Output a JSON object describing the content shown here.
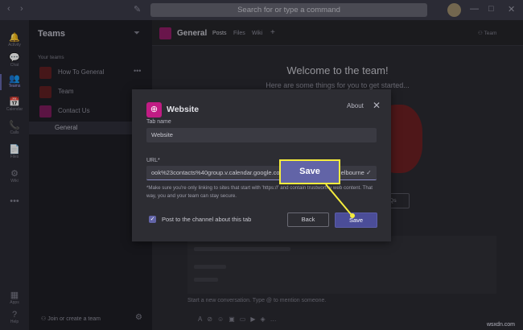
{
  "titlebar": {
    "back_icon": "‹",
    "forward_icon": "›",
    "compose_icon": "✎",
    "search_placeholder": "Search for or type a command",
    "minimize": "—",
    "maximize": "□",
    "close": "✕"
  },
  "rail": {
    "items": [
      {
        "icon": "bell-icon",
        "glyph": "🔔",
        "label": "Activity"
      },
      {
        "icon": "chat-icon",
        "glyph": "💬",
        "label": "Chat"
      },
      {
        "icon": "teams-icon",
        "glyph": "👥",
        "label": "Teams"
      },
      {
        "icon": "calendar-icon",
        "glyph": "📅",
        "label": "Calendar"
      },
      {
        "icon": "calls-icon",
        "glyph": "📞",
        "label": "Calls"
      },
      {
        "icon": "files-icon",
        "glyph": "📄",
        "label": "Files"
      },
      {
        "icon": "wiki-icon",
        "glyph": "⚙",
        "label": "Wiki"
      },
      {
        "icon": "more-icon",
        "glyph": "•••",
        "label": ""
      },
      {
        "icon": "apps-icon",
        "glyph": "▦",
        "label": "Apps"
      },
      {
        "icon": "help-icon",
        "glyph": "?",
        "label": "Help"
      }
    ]
  },
  "panel": {
    "title": "Teams",
    "your_teams_label": "Your teams",
    "teams": [
      {
        "name": "How To General"
      },
      {
        "name": "Team"
      },
      {
        "name": "Contact Us"
      }
    ],
    "channel": "General",
    "join_label": "Join or create a team"
  },
  "channel_header": {
    "name": "General",
    "tabs": [
      "Posts",
      "Files",
      "Wiki"
    ],
    "add_tab": "+",
    "team_button": "Team"
  },
  "welcome": {
    "title": "Welcome to the team!",
    "subtitle": "Here are some things for you to get started...",
    "faqs_button": "FAQs"
  },
  "compose": {
    "placeholder": "Start a new conversation. Type @ to mention someone."
  },
  "dialog": {
    "title": "Website",
    "about": "About",
    "tab_name_label": "Tab name",
    "tab_name_value": "Website",
    "url_label": "URL*",
    "url_value": "ook%23contacts%40group.v.calendar.google.com&ctz=Australia%2FMelbourne",
    "hint": "*Make sure you're only linking to sites that start with 'https://' and contain trustworthy web content. That way, you and your team can stay secure.",
    "post_checkbox_label": "Post to the channel about this tab",
    "post_checked": true,
    "back_button": "Back",
    "save_button": "Save"
  },
  "callout": {
    "label": "Save",
    "border_color": "#f5ec3d",
    "fill_color": "#6264a7"
  },
  "watermark": "wsxdn.com"
}
